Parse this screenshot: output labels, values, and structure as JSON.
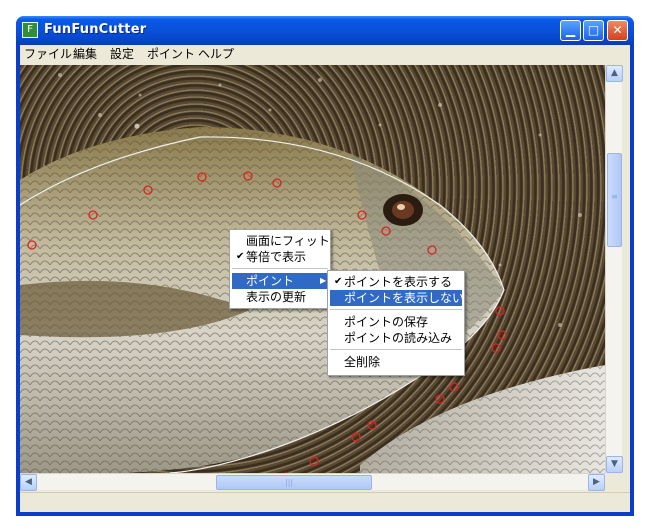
{
  "window": {
    "title": "FunFunCutter",
    "app_icon_glyph": "F"
  },
  "titlebar_buttons": {
    "minimize": "▁",
    "maximize": "□",
    "close": "✕"
  },
  "menubar": {
    "items": [
      "ファイル",
      "編集",
      "設定",
      "ポイント",
      "ヘルプ"
    ]
  },
  "context_menu": {
    "items": [
      {
        "label": "画面にフィット",
        "checked": false
      },
      {
        "label": "等倍で表示",
        "checked": true
      },
      {
        "label": "ポイント",
        "submenu": true,
        "highlighted": true
      },
      {
        "label": "表示の更新",
        "checked": false
      }
    ]
  },
  "submenu": {
    "items": [
      {
        "label": "ポイントを表示する",
        "checked": true
      },
      {
        "label": "ポイントを表示しない",
        "highlighted": true
      },
      {
        "label": "ポイントの保存"
      },
      {
        "label": "ポイントの読み込み"
      },
      {
        "label": "全削除"
      }
    ]
  },
  "scrollbar_glyphs": {
    "up": "▲",
    "down": "▼",
    "left": "◀",
    "right": "▶",
    "grip_v": "≡",
    "grip_h": "|||"
  },
  "colors": {
    "highlight": "#316ac5",
    "point_marker": "#e02020",
    "titlebar": "#0a4fd8"
  },
  "icons": {
    "check": "check-icon",
    "submenu_arrow": "chevron-right-icon"
  }
}
